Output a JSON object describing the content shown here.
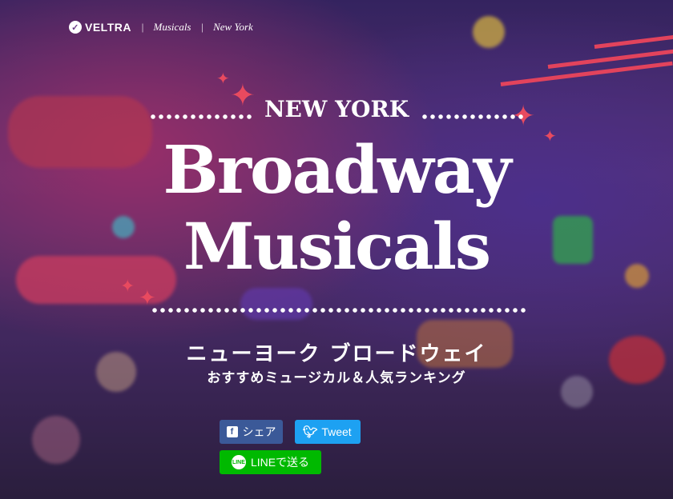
{
  "nav": {
    "brand": "VELTRA",
    "separator": "|",
    "crumb1": "Musicals",
    "crumb2": "New York"
  },
  "hero": {
    "supertitle": "NEW YORK",
    "title_line1": "Broadway",
    "title_line2": "Musicals",
    "jp_title": "ニューヨーク ブロードウェイ",
    "jp_subtitle": "おすすめミュージカル＆人気ランキング"
  },
  "share": {
    "facebook_label": "シェア",
    "twitter_label": "Tweet",
    "line_label": "LINEで送る",
    "line_icon_text": "LINE"
  },
  "icons": {
    "facebook": "facebook-icon",
    "twitter": "twitter-icon",
    "line": "line-icon",
    "sparkle": "sparkle-icon"
  },
  "colors": {
    "facebook": "#3b5998",
    "twitter": "#1da1f2",
    "line": "#00b900",
    "accent": "#e2435c"
  }
}
